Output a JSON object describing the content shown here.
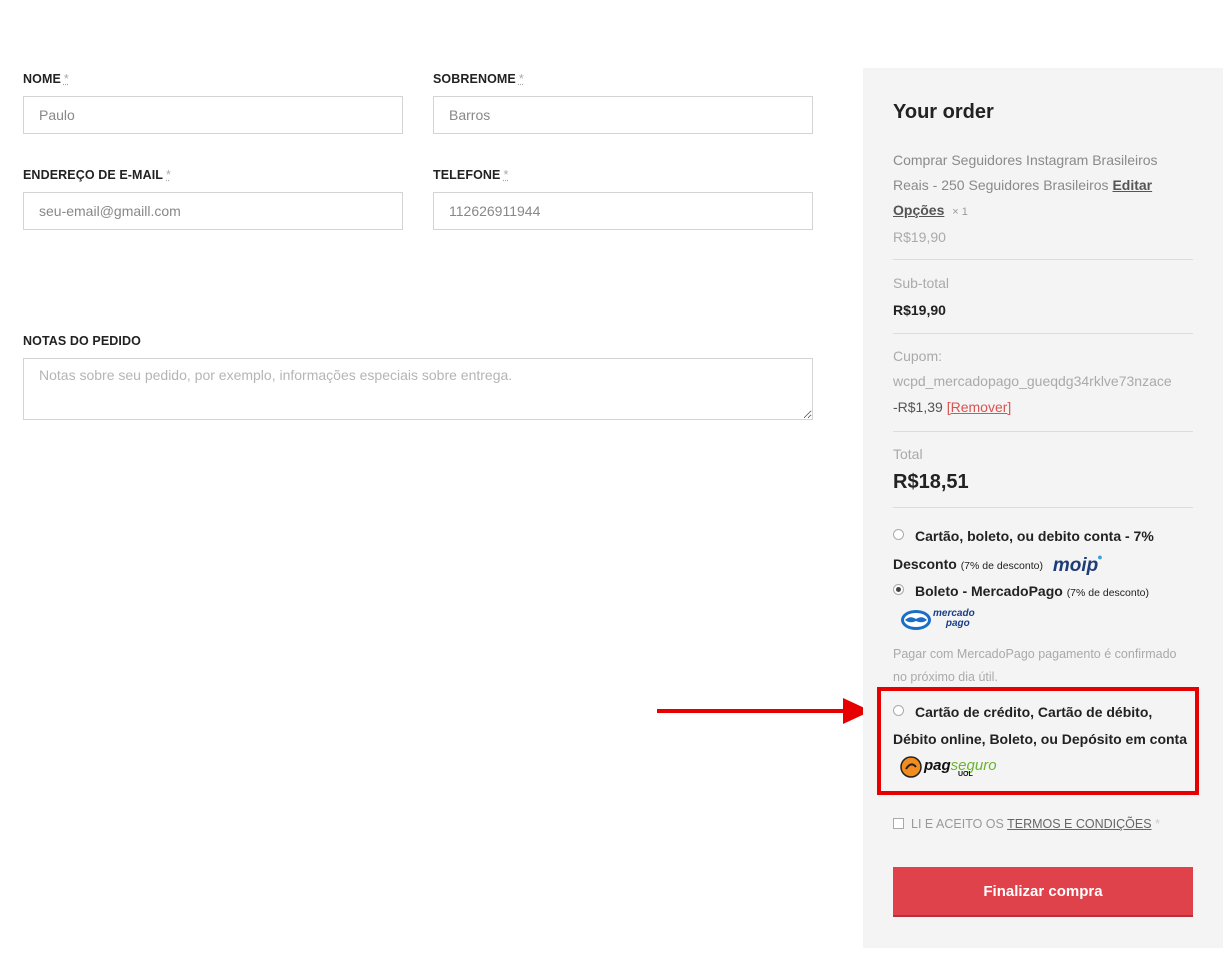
{
  "form": {
    "first_name_label": "NOME",
    "first_name_value": "Paulo",
    "last_name_label": "SOBRENOME",
    "last_name_value": "Barros",
    "email_label": "ENDEREÇO DE E-MAIL",
    "email_value": "seu-email@gmaill.com",
    "phone_label": "TELEFONE",
    "phone_value": "112626911944",
    "required_mark": "*",
    "notes_label": "NOTAS DO PEDIDO",
    "notes_placeholder": "Notas sobre seu pedido, por exemplo, informações especiais sobre entrega."
  },
  "order": {
    "title": "Your order",
    "product_name": "Comprar Seguidores Instagram Brasileiros Reais - 250 Seguidores Brasileiros",
    "edit_link": "Editar Opções",
    "quantity": "× 1",
    "product_price": "R$19,90",
    "subtotal_label": "Sub-total",
    "subtotal_value": "R$19,90",
    "coupon_label": "Cupom:",
    "coupon_code": "wcpd_mercadopago_gueqdg34rklve73nzace",
    "coupon_discount": "-R$1,39",
    "coupon_remove": "[Remover]",
    "total_label": "Total",
    "total_value": "R$18,51"
  },
  "payment": {
    "moip_label_1": "Cartão, boleto, ou debito conta - 7%",
    "moip_label_2": "Desconto",
    "moip_discount": "(7% de desconto)",
    "moip_logo": "moip",
    "mp_label": "Boleto - MercadoPago",
    "mp_discount": "(7% de desconto)",
    "mp_logo_1": "mercado",
    "mp_logo_2": "pago",
    "mp_description": "Pagar com MercadoPago pagamento é confirmado no próximo dia útil.",
    "pagseguro_label": "Cartão de crédito, Cartão de débito, Débito online, Boleto, ou Depósito em conta",
    "pagseguro_logo_1": "pag",
    "pagseguro_logo_2": "seguro",
    "pagseguro_logo_3": "UOL",
    "selected": "mercadopago"
  },
  "terms": {
    "prefix": "LI E ACEITO OS",
    "link": "TERMOS E CONDIÇÕES",
    "required_mark": "*"
  },
  "submit_label": "Finalizar compra",
  "colors": {
    "accent_button": "#e0424b",
    "annotation_red": "#e60000",
    "sidebar_bg": "#f4f4f4"
  }
}
